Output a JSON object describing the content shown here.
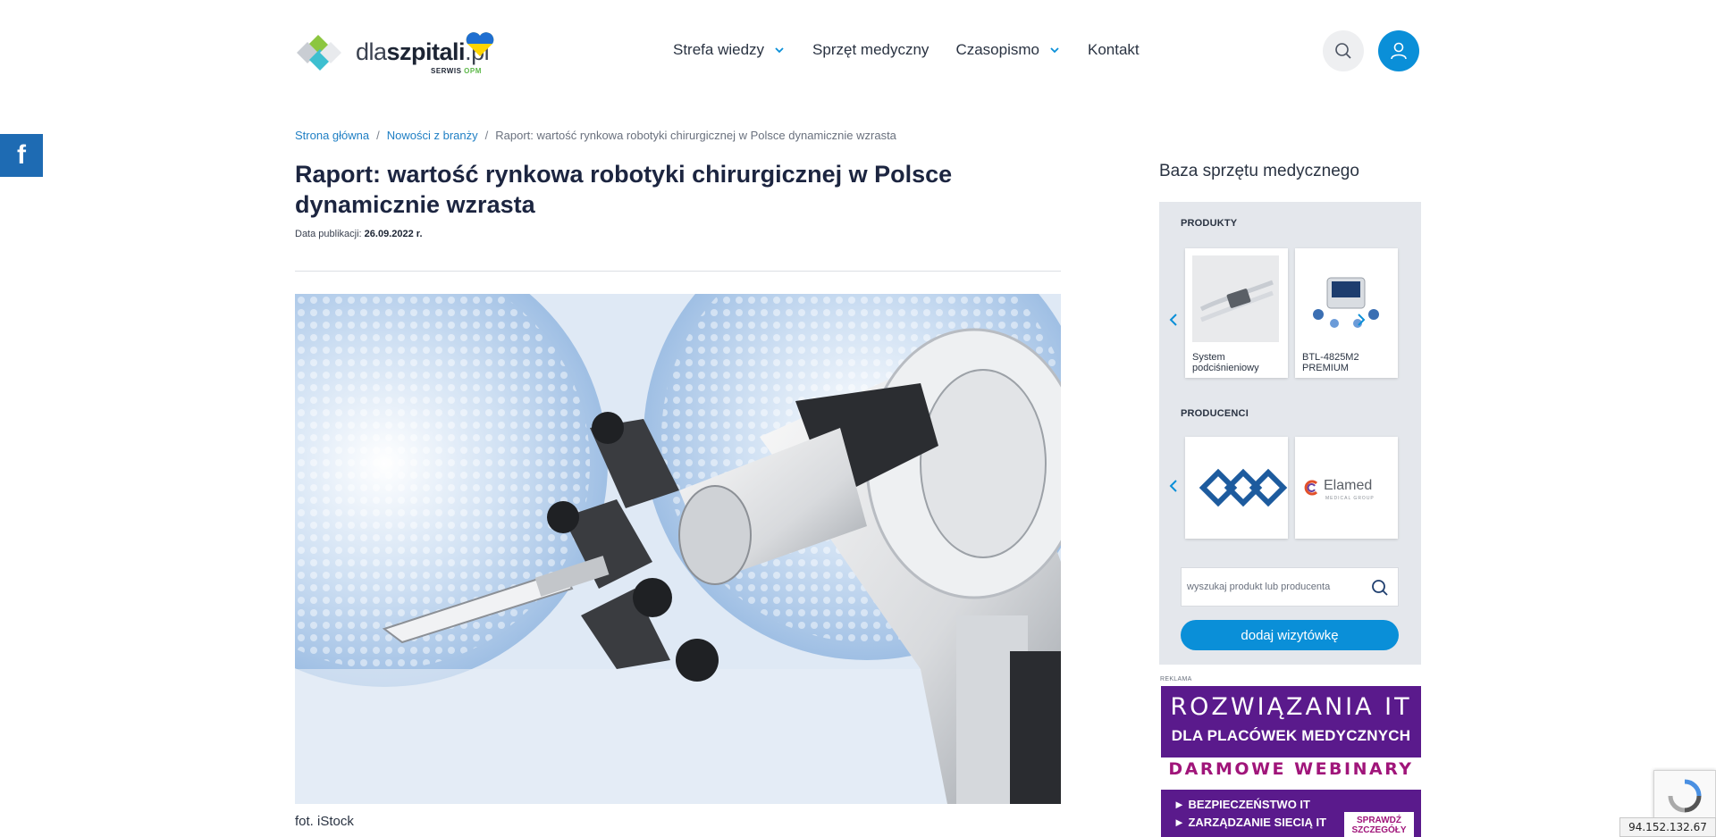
{
  "header": {
    "logo": {
      "text_light": "dla",
      "text_bold": "szpitali",
      "text_tld": ".pl",
      "subtitle_a": "SERWIS",
      "subtitle_b": "OPM"
    },
    "nav": [
      {
        "label": "Strefa wiedzy",
        "has_dropdown": true
      },
      {
        "label": "Sprzęt medyczny",
        "has_dropdown": false
      },
      {
        "label": "Czasopismo",
        "has_dropdown": true
      },
      {
        "label": "Kontakt",
        "has_dropdown": false
      }
    ],
    "icons": {
      "search": "search-icon",
      "user": "user-icon"
    }
  },
  "social": {
    "facebook": "f"
  },
  "breadcrumb": {
    "home": "Strona główna",
    "section": "Nowości z branży",
    "current": "Raport: wartość rynkowa robotyki chirurgicznej w Polsce dynamicznie wzrasta",
    "separator": "/"
  },
  "article": {
    "title": "Raport: wartość rynkowa robotyki chirurgicznej w Polsce dynamicznie wzrasta",
    "date_label": "Data publikacji:",
    "date_value": "26.09.2022 r.",
    "caption": "fot. iStock"
  },
  "sidebar": {
    "title": "Baza sprzętu medycznego",
    "products_label": "PRODUKTY",
    "products": [
      {
        "name": "System podciśnieniowy"
      },
      {
        "name": "BTL-4825M2 PREMIUM"
      }
    ],
    "producers_label": "PRODUCENCI",
    "producers": [
      {
        "name": "BTL"
      },
      {
        "name": "Elamed",
        "tagline": "MEDICAL GROUP"
      }
    ],
    "search_placeholder": "wyszukaj produkt lub producenta",
    "add_button": "dodaj wizytówkę"
  },
  "ad": {
    "label": "REKLAMA",
    "line1": "ROZWIĄZANIA IT",
    "line2": "DLA PLACÓWEK MEDYCZNYCH",
    "line3": "DARMOWE WEBINARY",
    "bullet1": "► BEZPIECZEŃSTWO IT",
    "bullet2": "► ZARZĄDZANIE SIECIĄ IT",
    "cta": "SPRAWDŹ SZCZEGÓŁY"
  },
  "ip": "94.152.132.67",
  "colors": {
    "accent": "#0a8fd8",
    "facebook": "#1e6bb3",
    "ad_purple": "#5a1a8c",
    "ad_magenta": "#a0157a"
  }
}
